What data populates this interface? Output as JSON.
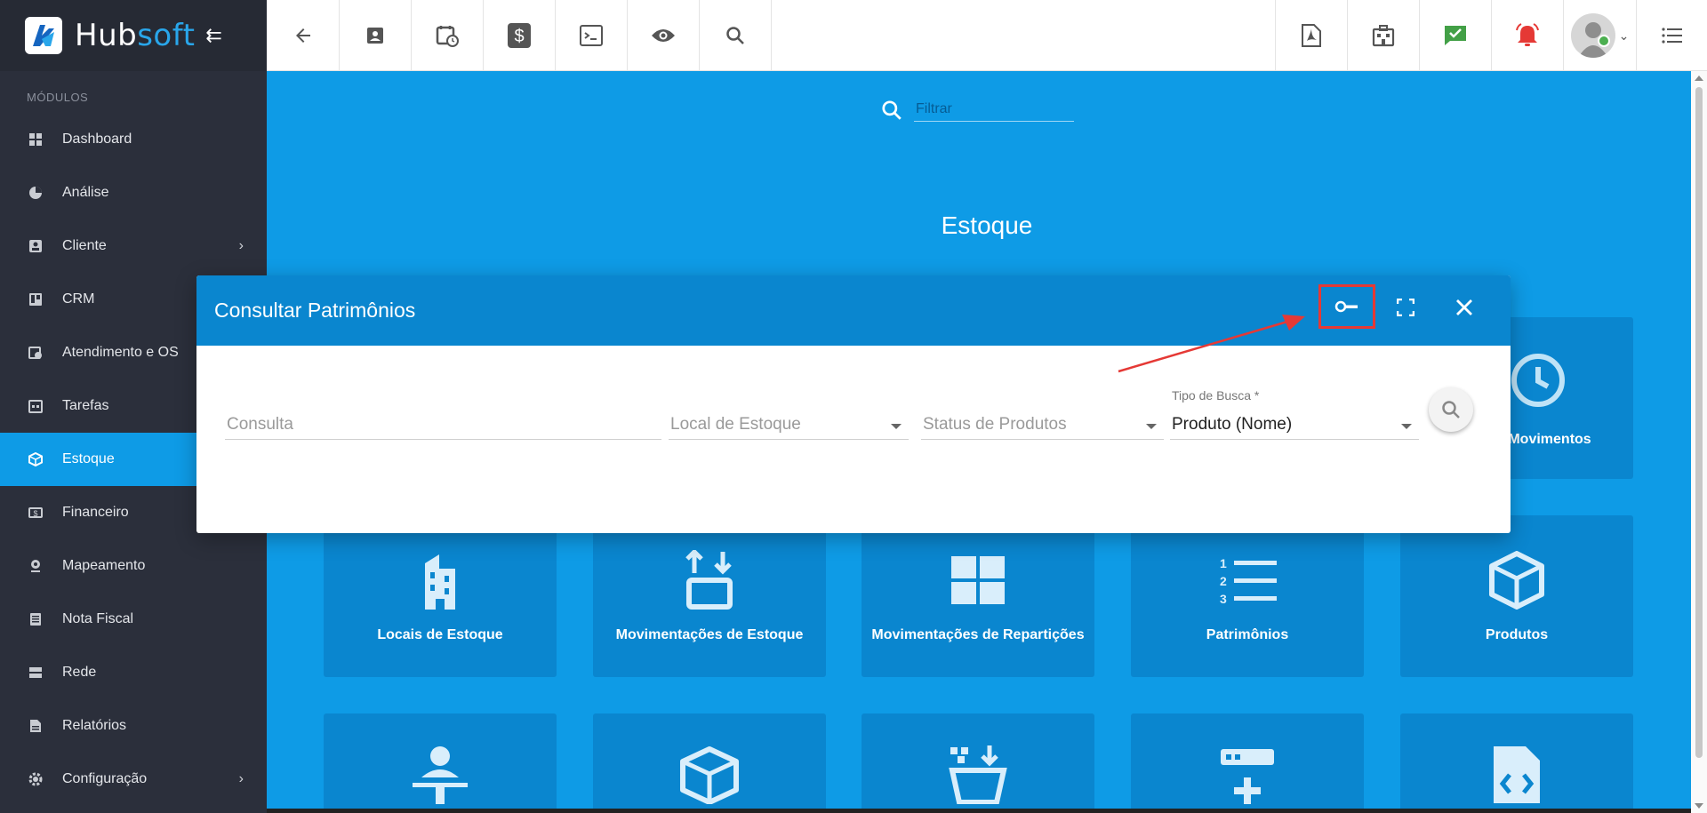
{
  "brand": {
    "name_part1": "Hub",
    "name_part2": "soft"
  },
  "sidebar": {
    "section_title": "MÓDULOS",
    "items": [
      {
        "label": "Dashboard",
        "icon": "dashboard-icon"
      },
      {
        "label": "Análise",
        "icon": "pie-chart-icon"
      },
      {
        "label": "Cliente",
        "icon": "contact-card-icon",
        "chevron": true
      },
      {
        "label": "CRM",
        "icon": "trello-board-icon"
      },
      {
        "label": "Atendimento e OS",
        "icon": "calendar-clock-icon"
      },
      {
        "label": "Tarefas",
        "icon": "calendar-tasks-icon"
      },
      {
        "label": "Estoque",
        "icon": "box-icon",
        "active": true
      },
      {
        "label": "Financeiro",
        "icon": "money-icon"
      },
      {
        "label": "Mapeamento",
        "icon": "map-pin-icon"
      },
      {
        "label": "Nota Fiscal",
        "icon": "document-list-icon"
      },
      {
        "label": "Rede",
        "icon": "server-icon"
      },
      {
        "label": "Relatórios",
        "icon": "report-icon"
      },
      {
        "label": "Configuração",
        "icon": "gear-icon",
        "chevron": true
      }
    ]
  },
  "topbar": {
    "left_icons": [
      "back-arrow-icon",
      "contact-icon",
      "calendar-clock-icon",
      "dollar-icon",
      "terminal-icon",
      "eye-icon",
      "search-icon"
    ],
    "right_icons": [
      "pdf-icon",
      "building-icon",
      "chat-check-icon",
      "alarm-icon",
      "avatar",
      "list-menu-icon"
    ]
  },
  "content": {
    "filter_placeholder": "Filtrar",
    "section_title": "Estoque",
    "tiles_row1_partial": "e Movimentos",
    "tiles_row2": [
      {
        "label": "Locais de Estoque",
        "icon": "building-icon"
      },
      {
        "label": "Movimentações de Estoque",
        "icon": "box-arrows-icon"
      },
      {
        "label": "Movimentações de Repartições",
        "icon": "grid-icon"
      },
      {
        "label": "Patrimônios",
        "icon": "numbered-list-icon"
      },
      {
        "label": "Produtos",
        "icon": "cube-icon"
      }
    ],
    "tiles_row3_icons": [
      "person-desk-icon",
      "open-box-icon",
      "basket-download-icon",
      "add-row-icon",
      "code-file-icon"
    ]
  },
  "dialog": {
    "title": "Consultar Patrimônios",
    "fields": {
      "consulta_placeholder": "Consulta",
      "local_estoque": "Local de Estoque",
      "status_produtos": "Status de Produtos",
      "tipo_busca_label": "Tipo de Busca *",
      "tipo_busca_value": "Produto (Nome)"
    }
  },
  "colors": {
    "primary": "#0e9be6",
    "header": "#0a86cf",
    "sidebar": "#2b2f3b",
    "annotation": "#e53935"
  }
}
